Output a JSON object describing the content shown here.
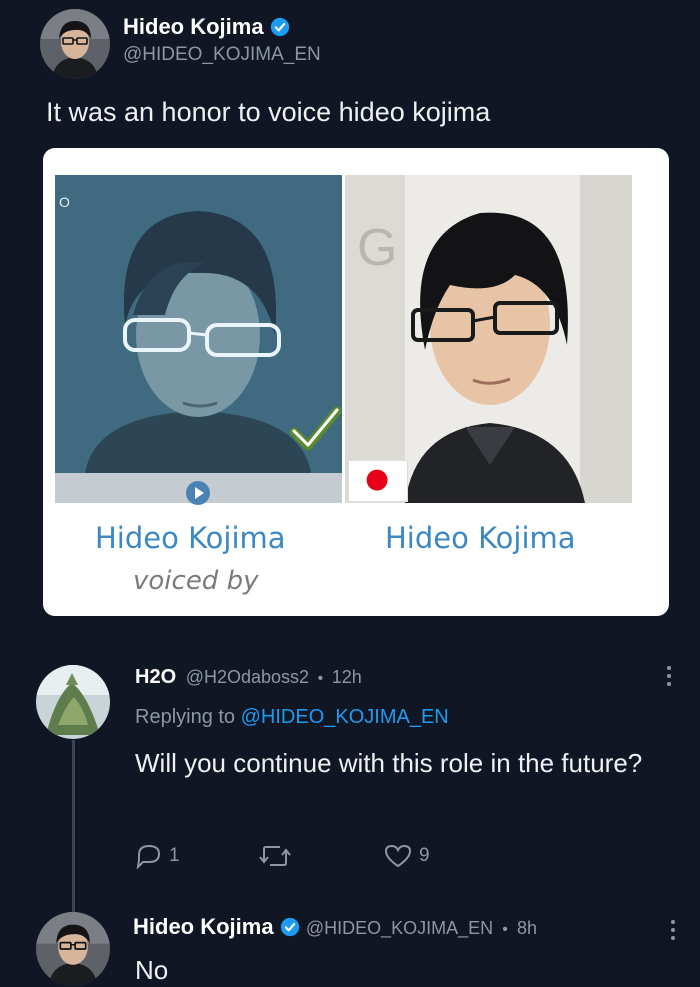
{
  "tweet": {
    "author_name": "Hideo Kojima",
    "handle": "@HIDEO_KOJIMA_EN",
    "text": "It was an honor to voice hideo kojima",
    "card": {
      "left_caption": "Hideo Kojima",
      "left_subcaption": "voiced by",
      "right_caption": "Hideo Kojima",
      "sign_text": "G"
    }
  },
  "reply": {
    "author_name": "H2O",
    "handle": "@H2Odaboss2",
    "separator": "•",
    "time": "12h",
    "replying_prefix": "Replying to",
    "replying_handle": "@HIDEO_KOJIMA_EN",
    "text": "Will you continue with this role in the future?",
    "reply_count": "1",
    "retweet_count": "",
    "like_count": "9"
  },
  "second_reply": {
    "author_name": "Hideo Kojima",
    "handle": "@HIDEO_KOJIMA_EN",
    "separator": "•",
    "time": "8h",
    "text": "No"
  },
  "icons": {
    "verified": "verified-badge-icon",
    "more": "more-dots-icon",
    "reply": "reply-icon",
    "retweet": "retweet-icon",
    "like": "heart-icon",
    "play": "play-icon",
    "check": "checkmark-icon",
    "flag": "japan-flag-icon"
  },
  "colors": {
    "background": "#111624",
    "accent": "#1d9bf0",
    "muted": "#8d96a3",
    "caption": "#3b88c4"
  }
}
